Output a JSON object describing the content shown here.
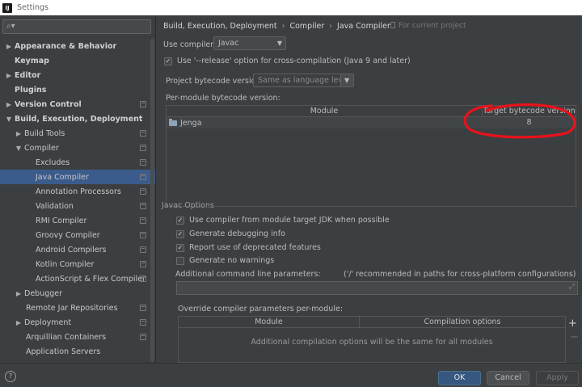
{
  "window": {
    "title": "Settings",
    "app_icon": "intellij-app-icon"
  },
  "search": {
    "value": "",
    "icon": "search-icon"
  },
  "sidebar": {
    "items": [
      {
        "label": "Appearance & Behavior",
        "bold": true,
        "arrow": "▶",
        "indent": 0,
        "cfg": false
      },
      {
        "label": "Keymap",
        "bold": true,
        "arrow": "",
        "indent": 0,
        "cfg": false
      },
      {
        "label": "Editor",
        "bold": true,
        "arrow": "▶",
        "indent": 0,
        "cfg": false
      },
      {
        "label": "Plugins",
        "bold": true,
        "arrow": "",
        "indent": 0,
        "cfg": false
      },
      {
        "label": "Version Control",
        "bold": true,
        "arrow": "▶",
        "indent": 0,
        "cfg": true
      },
      {
        "label": "Build, Execution, Deployment",
        "bold": true,
        "arrow": "▼",
        "indent": 0,
        "cfg": false
      },
      {
        "label": "Build Tools",
        "bold": false,
        "arrow": "▶",
        "indent": 1,
        "cfg": true
      },
      {
        "label": "Compiler",
        "bold": false,
        "arrow": "▼",
        "indent": 1,
        "cfg": true
      },
      {
        "label": "Excludes",
        "bold": false,
        "arrow": "",
        "indent": 2,
        "cfg": true
      },
      {
        "label": "Java Compiler",
        "bold": false,
        "arrow": "",
        "indent": 2,
        "cfg": true,
        "selected": true
      },
      {
        "label": "Annotation Processors",
        "bold": false,
        "arrow": "",
        "indent": 2,
        "cfg": true
      },
      {
        "label": "Validation",
        "bold": false,
        "arrow": "",
        "indent": 2,
        "cfg": true
      },
      {
        "label": "RMI Compiler",
        "bold": false,
        "arrow": "",
        "indent": 2,
        "cfg": true
      },
      {
        "label": "Groovy Compiler",
        "bold": false,
        "arrow": "",
        "indent": 2,
        "cfg": true
      },
      {
        "label": "Android Compilers",
        "bold": false,
        "arrow": "",
        "indent": 2,
        "cfg": true
      },
      {
        "label": "Kotlin Compiler",
        "bold": false,
        "arrow": "",
        "indent": 2,
        "cfg": true
      },
      {
        "label": "ActionScript & Flex Compiler",
        "bold": false,
        "arrow": "",
        "indent": 2,
        "cfg": true
      },
      {
        "label": "Debugger",
        "bold": false,
        "arrow": "▶",
        "indent": 1,
        "cfg": false
      },
      {
        "label": "Remote Jar Repositories",
        "bold": false,
        "arrow": "",
        "indent": 1,
        "cfg": true
      },
      {
        "label": "Deployment",
        "bold": false,
        "arrow": "▶",
        "indent": 1,
        "cfg": true
      },
      {
        "label": "Arquillian Containers",
        "bold": false,
        "arrow": "",
        "indent": 1,
        "cfg": true
      },
      {
        "label": "Application Servers",
        "bold": false,
        "arrow": "",
        "indent": 1,
        "cfg": false
      }
    ]
  },
  "breadcrumb": [
    "Build, Execution, Deployment",
    "Compiler",
    "Java Compiler"
  ],
  "breadcrumb_sep": "›",
  "for_current_project": "For current project",
  "use_compiler": {
    "label": "Use compiler:",
    "value": "Javac"
  },
  "release_option": {
    "label": "Use '--release' option for cross-compilation (Java 9 and later)",
    "checked": true
  },
  "bytecode_version": {
    "label": "Project bytecode version:",
    "value": "Same as language level"
  },
  "per_module": {
    "label": "Per-module bytecode version:",
    "columns": [
      "Module",
      "Target bytecode version"
    ],
    "rows": [
      {
        "module": "Jenga",
        "version": "8"
      }
    ]
  },
  "javac_options": {
    "title": "Javac Options",
    "checkboxes": [
      {
        "label": "Use compiler from module target JDK when possible",
        "checked": true
      },
      {
        "label": "Generate debugging info",
        "checked": true
      },
      {
        "label": "Report use of deprecated features",
        "checked": true
      },
      {
        "label": "Generate no warnings",
        "checked": false
      }
    ],
    "additional_label": "Additional command line parameters:",
    "additional_hint": "('/' recommended in paths for cross-platform configurations)",
    "additional_value": ""
  },
  "override": {
    "label": "Override compiler parameters per-module:",
    "columns": [
      "Module",
      "Compilation options"
    ],
    "empty_text": "Additional compilation options will be the same for all modules",
    "add": "+",
    "remove": "−"
  },
  "buttons": {
    "help": "?",
    "ok": "OK",
    "cancel": "Cancel",
    "apply": "Apply"
  },
  "annotation_color": "#e8121b"
}
